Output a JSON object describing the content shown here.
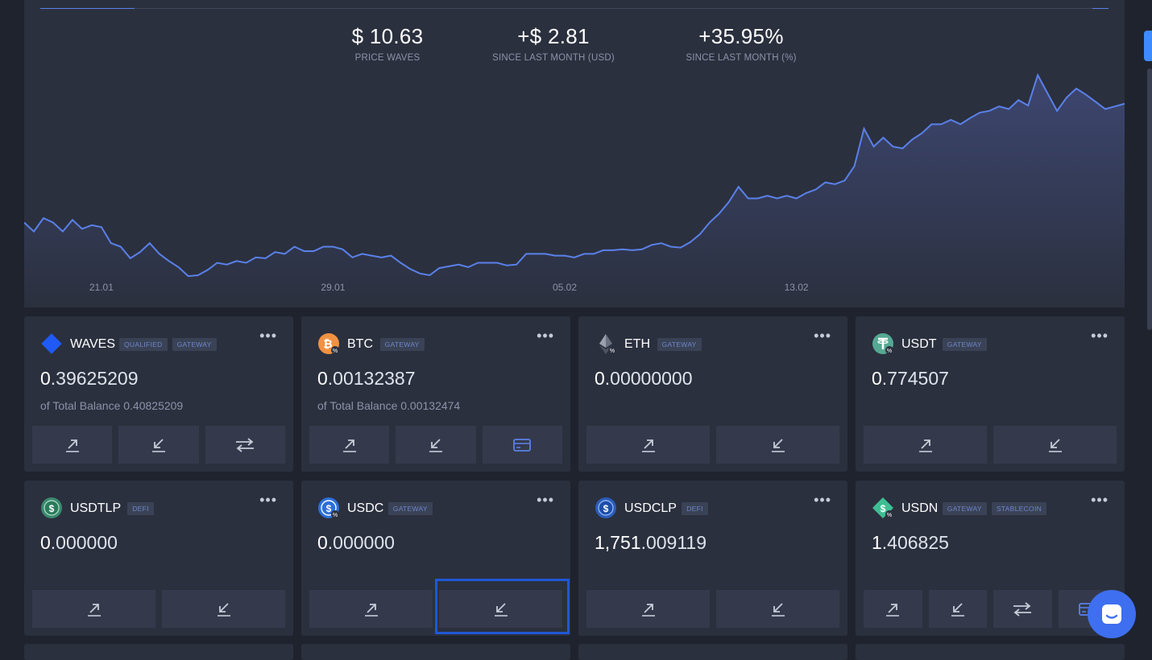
{
  "stats": [
    {
      "value": "$ 10.63",
      "label": "PRICE WAVES"
    },
    {
      "value": "+$ 2.81",
      "label": "SINCE LAST MONTH (USD)"
    },
    {
      "value": "+35.95%",
      "label": "SINCE LAST MONTH (%)"
    }
  ],
  "chart_data": {
    "type": "area",
    "title": "",
    "xlabel": "",
    "ylabel": "",
    "x_ticks": [
      "21.01",
      "29.01",
      "05.02",
      "13.02"
    ],
    "tick_positions": [
      8,
      32,
      56,
      80
    ],
    "values": [
      7.95,
      7.85,
      8.0,
      7.95,
      7.85,
      7.98,
      7.88,
      7.92,
      7.9,
      7.72,
      7.68,
      7.55,
      7.62,
      7.72,
      7.6,
      7.52,
      7.45,
      7.35,
      7.36,
      7.42,
      7.5,
      7.48,
      7.52,
      7.5,
      7.56,
      7.55,
      7.62,
      7.6,
      7.68,
      7.63,
      7.63,
      7.68,
      7.68,
      7.65,
      7.56,
      7.6,
      7.58,
      7.56,
      7.58,
      7.5,
      7.43,
      7.38,
      7.36,
      7.44,
      7.46,
      7.48,
      7.45,
      7.5,
      7.5,
      7.5,
      7.47,
      7.48,
      7.6,
      7.6,
      7.6,
      7.58,
      7.58,
      7.56,
      7.6,
      7.6,
      7.64,
      7.64,
      7.65,
      7.64,
      7.65,
      7.7,
      7.72,
      7.68,
      7.67,
      7.73,
      7.82,
      7.95,
      8.05,
      8.18,
      8.35,
      8.22,
      8.22,
      8.25,
      8.22,
      8.25,
      8.22,
      8.28,
      8.32,
      8.4,
      8.38,
      8.42,
      8.58,
      9.0,
      8.8,
      8.9,
      8.8,
      8.78,
      8.88,
      8.95,
      9.05,
      9.05,
      9.1,
      9.05,
      9.12,
      9.18,
      9.2,
      9.25,
      9.22,
      9.32,
      9.26,
      9.6,
      9.4,
      9.2,
      9.35,
      9.45,
      9.38,
      9.3,
      9.22,
      9.25,
      9.28
    ],
    "ylim": [
      7.0,
      9.9
    ],
    "colors": {
      "line": "#5a81ea",
      "fill_top": "#3d4670",
      "fill_bottom": "#2b303e"
    }
  },
  "cards": [
    {
      "name": "WAVES",
      "icon": "waves-icon",
      "tags": [
        "QUALIFIED",
        "GATEWAY"
      ],
      "int": "0",
      "frac": ".39625209",
      "total": "of Total Balance 0.40825209",
      "actions": [
        "send",
        "receive",
        "exchange"
      ]
    },
    {
      "name": "BTC",
      "icon": "btc-icon",
      "tags": [
        "GATEWAY"
      ],
      "int": "0",
      "frac": ".00132387",
      "total": "of Total Balance 0.00132474",
      "actions": [
        "send",
        "receive",
        "card"
      ]
    },
    {
      "name": "ETH",
      "icon": "eth-icon",
      "tags": [
        "GATEWAY"
      ],
      "int": "0",
      "frac": ".00000000",
      "total": "",
      "actions": [
        "send",
        "receive"
      ]
    },
    {
      "name": "USDT",
      "icon": "usdt-icon",
      "tags": [
        "GATEWAY"
      ],
      "int": "0",
      "frac": ".774507",
      "total": "",
      "actions": [
        "send",
        "receive"
      ]
    },
    {
      "name": "USDTLP",
      "icon": "usdtlp-icon",
      "tags": [
        "DEFI"
      ],
      "int": "0",
      "frac": ".000000",
      "total": "",
      "actions": [
        "send",
        "receive"
      ]
    },
    {
      "name": "USDC",
      "icon": "usdc-icon",
      "tags": [
        "GATEWAY"
      ],
      "int": "0",
      "frac": ".000000",
      "total": "",
      "actions": [
        "send",
        "receive"
      ]
    },
    {
      "name": "USDCLP",
      "icon": "usdclp-icon",
      "tags": [
        "DEFI"
      ],
      "int": "1,751",
      "frac": ".009119",
      "total": "",
      "actions": [
        "send",
        "receive"
      ]
    },
    {
      "name": "USDN",
      "icon": "usdn-icon",
      "tags": [
        "GATEWAY",
        "STABLECOIN"
      ],
      "int": "1",
      "frac": ".406825",
      "total": "",
      "actions": [
        "send",
        "receive",
        "exchange",
        "card"
      ]
    }
  ],
  "menu_glyph": "•••",
  "colors": {
    "accent": "#5a81ea",
    "panel": "#2b303e",
    "background": "#1f232e",
    "button": "#343a4b",
    "highlight": "#1f57d6"
  }
}
